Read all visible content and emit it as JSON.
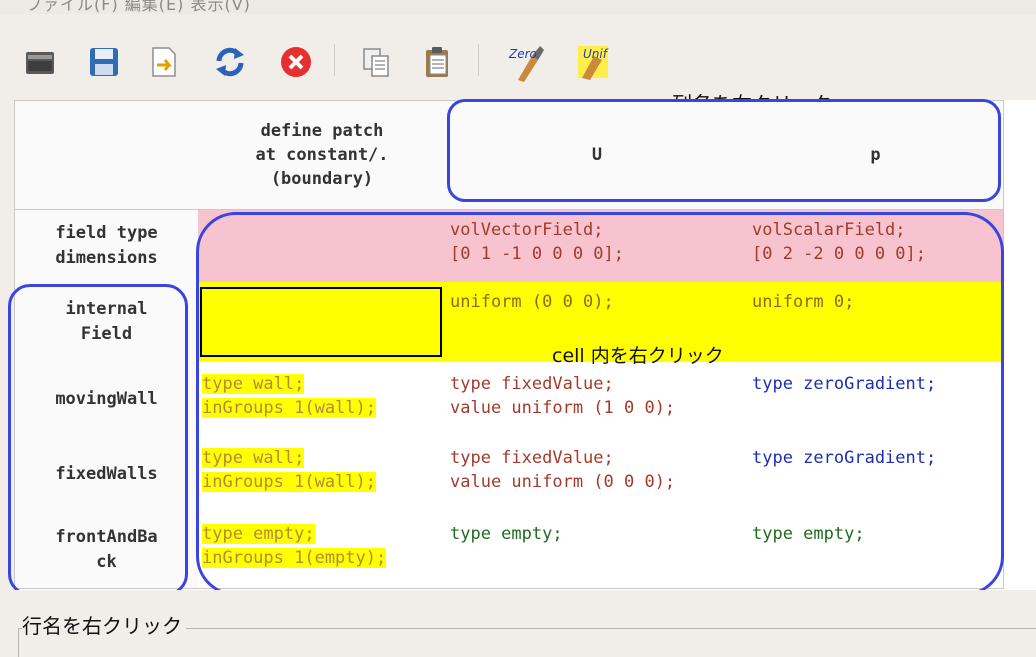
{
  "menubar": {
    "text": "ファイル(F)   編集(E)   表示(V)"
  },
  "toolbar": {
    "buttons": [
      {
        "name": "open-folder-icon",
        "label": ""
      },
      {
        "name": "save-icon",
        "label": ""
      },
      {
        "name": "import-icon",
        "label": ""
      },
      {
        "name": "reload-icon",
        "label": ""
      },
      {
        "name": "close-icon",
        "label": ""
      },
      {
        "name": "copy-icon",
        "label": ""
      },
      {
        "name": "paste-icon",
        "label": ""
      },
      {
        "name": "zero-icon",
        "label": "Zero"
      },
      {
        "name": "unif-icon",
        "label": "Unif"
      }
    ]
  },
  "annotations": {
    "column": "列名を右クリック",
    "cell": "cell 内を右クリック",
    "row": "行名を右クリック"
  },
  "table": {
    "headers": {
      "corner": "",
      "patch": "define patch\nat constant/.\n(boundary)",
      "U": "U",
      "p": "p"
    },
    "rows": [
      {
        "name": "field type\ndimensions",
        "patch": "",
        "U": "volVectorField;\n[0 1 -1 0 0 0 0];",
        "p": "volScalarField;\n[0 2 -2 0 0 0 0];"
      },
      {
        "name": "internal\nField",
        "patch": "",
        "U": "uniform (0 0 0);",
        "p": "uniform 0;"
      },
      {
        "name": "movingWall",
        "patch": "type wall;\ninGroups 1(wall);",
        "U": "type fixedValue;\nvalue uniform (1 0 0);",
        "p": "type zeroGradient;"
      },
      {
        "name": "fixedWalls",
        "patch": "type wall;\ninGroups 1(wall);",
        "U": "type fixedValue;\nvalue uniform (0 0 0);",
        "p": "type zeroGradient;"
      },
      {
        "name": "frontAndBa\nck",
        "patch": "type empty;\ninGroups 1(empty);",
        "U": "type empty;",
        "p": "type empty;"
      }
    ]
  },
  "colors": {
    "header_row_bg": "#f7c3ce",
    "highlight": "#ffff00",
    "annotation_outline": "#3a45e0"
  }
}
